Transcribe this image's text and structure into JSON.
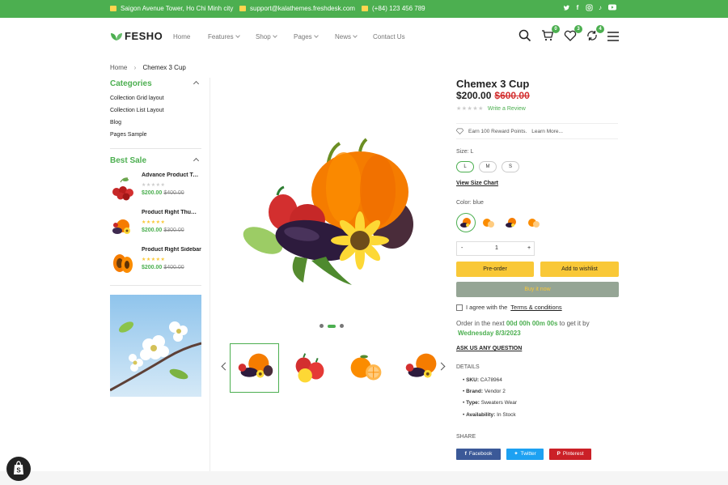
{
  "topbar": {
    "address": "Saigon Avenue Tower, Ho Chi Minh city",
    "email": "support@kalathemes.freshdesk.com",
    "phone": "(+84) 123 456 789",
    "socials": [
      "twitter-icon",
      "facebook-icon",
      "instagram-icon",
      "tiktok-icon",
      "youtube-icon"
    ]
  },
  "header": {
    "logo": "FESHO",
    "nav": [
      {
        "label": "Home",
        "dropdown": false
      },
      {
        "label": "Features",
        "dropdown": true
      },
      {
        "label": "Shop",
        "dropdown": true
      },
      {
        "label": "Pages",
        "dropdown": true
      },
      {
        "label": "News",
        "dropdown": true
      },
      {
        "label": "Contact Us",
        "dropdown": false
      }
    ],
    "cart_count": "0",
    "wishlist_count": "3",
    "compare_count": "4"
  },
  "breadcrumb": {
    "home": "Home",
    "separator": "›",
    "current": "Chemex 3 Cup"
  },
  "sidebar": {
    "categories_title": "Categories",
    "categories": [
      "Collection Grid layout",
      "Collection List Layout",
      "Blog",
      "Pages Sample"
    ],
    "best_sale_title": "Best Sale",
    "best_sale": [
      {
        "title": "Advance Product Type",
        "stars": "★★★★★",
        "price": "$200.00",
        "old_price": "$400.00",
        "rated": false
      },
      {
        "title": "Product Right Thumbnails",
        "stars": "★★★★★",
        "price": "$200.00",
        "old_price": "$300.00",
        "rated": true
      },
      {
        "title": "Product Right Sidebar",
        "stars": "★★★★★",
        "price": "$200.00",
        "old_price": "$400.00",
        "rated": true
      }
    ]
  },
  "gallery": {
    "active_slide": 2,
    "total_slides": 3,
    "selected_thumb": 1
  },
  "product": {
    "title": "Chemex 3 Cup",
    "price": "$200.00",
    "old_price": "$600.00",
    "stars": "★★★★★",
    "review_link": "Write a Review",
    "reward_text": "Earn 100 Reward Points.",
    "reward_link": "Learn More...",
    "size_label": "Size: L",
    "sizes": [
      "L",
      "M",
      "S"
    ],
    "selected_size": "L",
    "size_chart": "View Size Chart",
    "color_label": "Color: blue",
    "quantity": "1",
    "qty_minus": "-",
    "qty_plus": "+",
    "preorder": "Pre-order",
    "wishlist": "Add to wishlist",
    "buy_now": "Buy it now",
    "agree_text": "I agree with the",
    "terms": "Terms & conditions",
    "order_prefix": "Order in the next",
    "countdown": "00d 00h 00m 00s",
    "order_suffix": "to get it by",
    "delivery_date": "Wednesday 8/3/2023",
    "ask": "ASK US ANY QUESTION",
    "details_title": "DETAILS",
    "details": [
      {
        "key": "SKU:",
        "value": "CA78964"
      },
      {
        "key": "Brand:",
        "value": "Vendor 2"
      },
      {
        "key": "Type:",
        "value": "Sweaters Wear"
      },
      {
        "key": "Availability:",
        "value": "In Stock"
      }
    ],
    "share_title": "SHARE",
    "share": [
      {
        "label": "Facebook",
        "color": "#3b5998"
      },
      {
        "label": "Twitter",
        "color": "#1da1f2"
      },
      {
        "label": "Pinterest",
        "color": "#cb2027"
      }
    ]
  },
  "colors": {
    "brand": "#4caf50",
    "accent": "#f9c837",
    "sale": "#d32f2f"
  }
}
